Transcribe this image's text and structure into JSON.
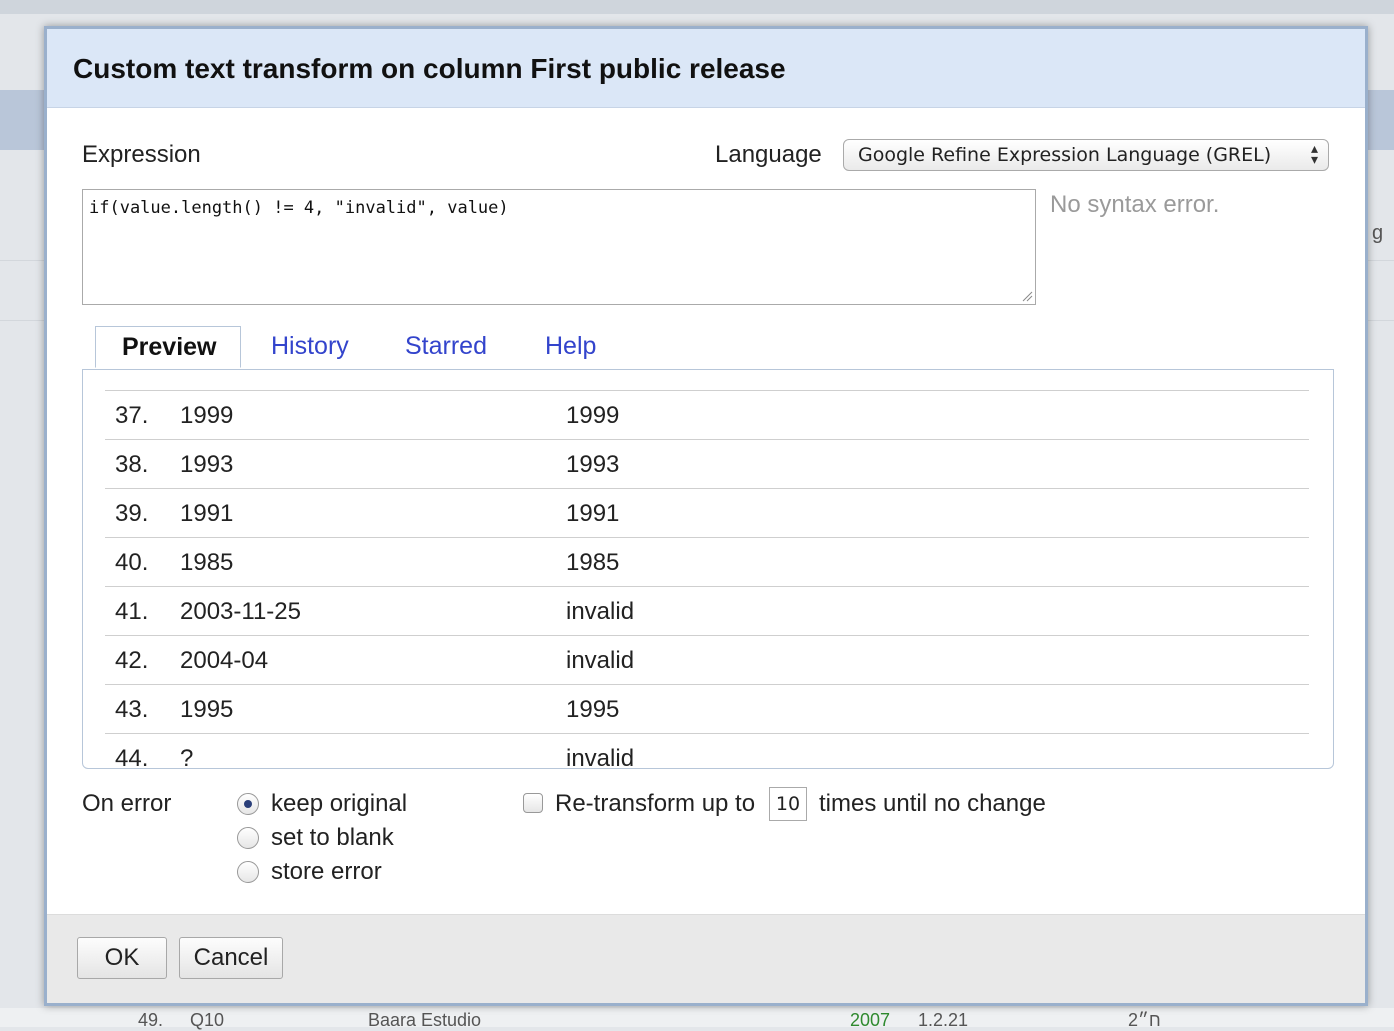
{
  "background": {
    "right_fragment": "g",
    "bottom_row": [
      "49.",
      "Q10",
      "Baara Estudio",
      "2007",
      "1.2.21",
      "ח״2"
    ]
  },
  "dialog": {
    "title": "Custom text transform on column First public release",
    "expression_label": "Expression",
    "expression_value": "if(value.length() != 4, \"invalid\", value)",
    "language_label": "Language",
    "language_selected": "Google Refine Expression Language (GREL)",
    "syntax_status": "No syntax error.",
    "tabs": [
      {
        "label": "Preview",
        "active": true
      },
      {
        "label": "History",
        "active": false
      },
      {
        "label": "Starred",
        "active": false
      },
      {
        "label": "Help",
        "active": false
      }
    ],
    "preview_rows": [
      {
        "index": "37.",
        "original": "1999",
        "result": "1999"
      },
      {
        "index": "38.",
        "original": "1993",
        "result": "1993"
      },
      {
        "index": "39.",
        "original": "1991",
        "result": "1991"
      },
      {
        "index": "40.",
        "original": "1985",
        "result": "1985"
      },
      {
        "index": "41.",
        "original": "2003-11-25",
        "result": "invalid"
      },
      {
        "index": "42.",
        "original": "2004-04",
        "result": "invalid"
      },
      {
        "index": "43.",
        "original": "1995",
        "result": "1995"
      },
      {
        "index": "44.",
        "original": "?",
        "result": "invalid"
      }
    ],
    "on_error": {
      "label": "On error",
      "options": [
        {
          "label": "keep original",
          "checked": true
        },
        {
          "label": "set to blank",
          "checked": false
        },
        {
          "label": "store error",
          "checked": false
        }
      ]
    },
    "retransform": {
      "checked": false,
      "label_before": "Re-transform up to",
      "times_value": "10",
      "label_after": "times until no change"
    },
    "buttons": {
      "ok": "OK",
      "cancel": "Cancel"
    }
  }
}
